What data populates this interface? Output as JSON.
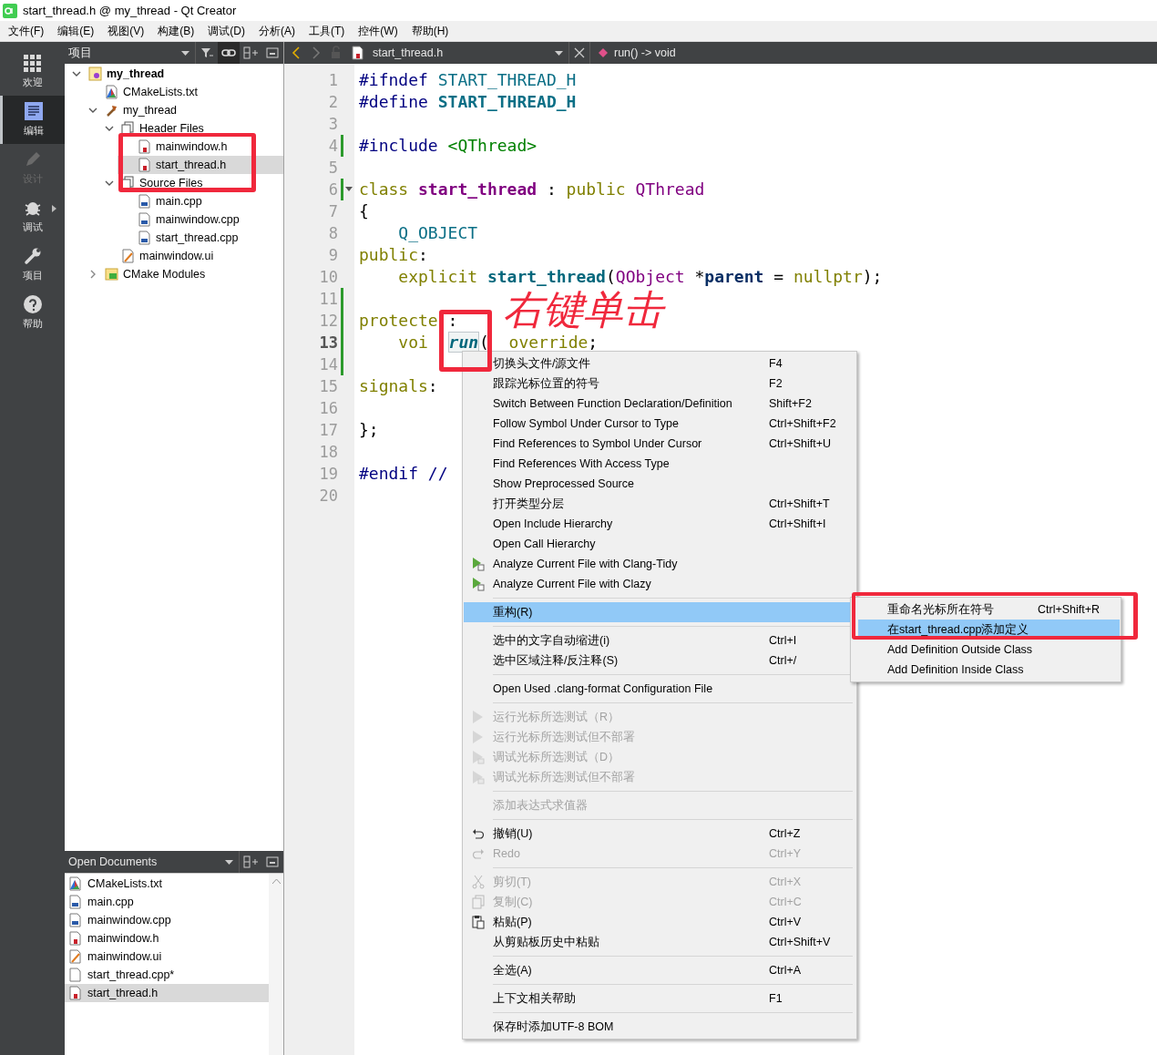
{
  "window": {
    "title": "start_thread.h @ my_thread - Qt Creator"
  },
  "menu_bar": [
    "文件(F)",
    "编辑(E)",
    "视图(V)",
    "构建(B)",
    "调试(D)",
    "分析(A)",
    "工具(T)",
    "控件(W)",
    "帮助(H)"
  ],
  "mode_bar": [
    {
      "label": "欢迎",
      "kind": "welcome",
      "selected": false,
      "disabled": false
    },
    {
      "label": "编辑",
      "kind": "edit",
      "selected": true,
      "disabled": false
    },
    {
      "label": "设计",
      "kind": "design",
      "selected": false,
      "disabled": true
    },
    {
      "label": "调试",
      "kind": "debug",
      "selected": false,
      "disabled": false
    },
    {
      "label": "项目",
      "kind": "projects",
      "selected": false,
      "disabled": false
    },
    {
      "label": "帮助",
      "kind": "help",
      "selected": false,
      "disabled": false
    }
  ],
  "project_panel": {
    "title": "项目",
    "tree": [
      {
        "label": "my_thread",
        "kind": "project",
        "expanded": true,
        "selected": false,
        "children": [
          {
            "label": "CMakeLists.txt",
            "kind": "cmake",
            "selected": false
          },
          {
            "label": "my_thread",
            "kind": "target",
            "expanded": true,
            "selected": false,
            "children": [
              {
                "label": "Header Files",
                "kind": "folder",
                "expanded": true,
                "selected": false,
                "children": [
                  {
                    "label": "mainwindow.h",
                    "kind": "header",
                    "selected": false
                  },
                  {
                    "label": "start_thread.h",
                    "kind": "header",
                    "selected": true
                  }
                ]
              },
              {
                "label": "Source Files",
                "kind": "folder",
                "expanded": true,
                "selected": false,
                "children": [
                  {
                    "label": "main.cpp",
                    "kind": "source",
                    "selected": false
                  },
                  {
                    "label": "mainwindow.cpp",
                    "kind": "source",
                    "selected": false
                  },
                  {
                    "label": "start_thread.cpp",
                    "kind": "source",
                    "selected": false
                  }
                ]
              },
              {
                "label": "mainwindow.ui",
                "kind": "form",
                "selected": false
              }
            ]
          },
          {
            "label": "CMake Modules",
            "kind": "modules",
            "expanded": false,
            "selected": false
          }
        ]
      }
    ]
  },
  "open_documents": {
    "title": "Open Documents",
    "items": [
      {
        "label": "CMakeLists.txt",
        "kind": "cmake",
        "selected": false
      },
      {
        "label": "main.cpp",
        "kind": "source",
        "selected": false
      },
      {
        "label": "mainwindow.cpp",
        "kind": "source",
        "selected": false
      },
      {
        "label": "mainwindow.h",
        "kind": "header",
        "selected": false
      },
      {
        "label": "mainwindow.ui",
        "kind": "form",
        "selected": false
      },
      {
        "label": "start_thread.cpp*",
        "kind": "plain",
        "selected": false
      },
      {
        "label": "start_thread.h",
        "kind": "header",
        "selected": true
      }
    ]
  },
  "editor": {
    "file": "start_thread.h",
    "symbol": "run() -> void",
    "lines": [
      {
        "number": "1",
        "tokens": [
          {
            "t": "#ifndef",
            "kind": "preproc"
          },
          {
            "t": " START_THREAD_H",
            "kind": "macro"
          }
        ]
      },
      {
        "number": "2",
        "tokens": [
          {
            "t": "#define",
            "kind": "preproc"
          },
          {
            "t": " START_THREAD_H",
            "kind": "macro-bold"
          }
        ]
      },
      {
        "number": "3"
      },
      {
        "number": "4",
        "changed": true,
        "tokens": [
          {
            "t": "#include",
            "kind": "preproc"
          },
          {
            "t": " <QThread>",
            "kind": "string"
          }
        ]
      },
      {
        "number": "5"
      },
      {
        "number": "6",
        "changed": true,
        "foldable": true,
        "tokens": [
          {
            "t": "class",
            "kind": "keyword"
          },
          {
            "t": " start_thread",
            "kind": "class-bold"
          },
          {
            "t": " :"
          },
          {
            "t": " public",
            "kind": "keyword"
          },
          {
            "t": " QThread",
            "kind": "type"
          }
        ]
      },
      {
        "number": "7",
        "tokens": [
          {
            "t": "{"
          }
        ]
      },
      {
        "number": "8",
        "tokens": [
          {
            "t": "    Q_OBJECT",
            "kind": "macro"
          }
        ]
      },
      {
        "number": "9",
        "tokens": [
          {
            "t": "public",
            "kind": "keyword"
          },
          {
            "t": ":"
          }
        ]
      },
      {
        "number": "10",
        "tokens": [
          {
            "t": "    explicit",
            "kind": "keyword"
          },
          {
            "t": " start_thread",
            "kind": "func-bold"
          },
          {
            "t": "("
          },
          {
            "t": "QObject",
            "kind": "type"
          },
          {
            "t": " *"
          },
          {
            "t": "parent",
            "kind": "param-bold"
          },
          {
            "t": " ="
          },
          {
            "t": " nullptr",
            "kind": "keyword"
          },
          {
            "t": ");"
          }
        ]
      },
      {
        "number": "11",
        "changed": true
      },
      {
        "number": "12",
        "changed": true,
        "tokens": [
          {
            "t": "protecte",
            "kind": "keyword"
          },
          {
            "t": " :"
          }
        ]
      },
      {
        "number": "13",
        "changed": true,
        "current": true,
        "tokens": [
          {
            "t": "    voi",
            "kind": "keyword"
          },
          {
            "t": "  run",
            "kind": "symbol"
          },
          {
            "t": "("
          },
          {
            "t": "  override",
            "kind": "keyword"
          },
          {
            "t": ";"
          }
        ]
      },
      {
        "number": "14",
        "changed": true
      },
      {
        "number": "15",
        "tokens": [
          {
            "t": "signals",
            "kind": "keyword"
          },
          {
            "t": ":"
          }
        ]
      },
      {
        "number": "16"
      },
      {
        "number": "17",
        "tokens": [
          {
            "t": "};"
          }
        ]
      },
      {
        "number": "18"
      },
      {
        "number": "19",
        "tokens": [
          {
            "t": "#endif //",
            "kind": "preproc"
          }
        ]
      },
      {
        "number": "20"
      }
    ]
  },
  "context_menu": {
    "items": [
      {
        "kind": "plain",
        "label": "切换头文件/源文件",
        "shortcut": "F4",
        "disabled": false,
        "selected": false
      },
      {
        "kind": "plain",
        "label": "跟踪光标位置的符号",
        "shortcut": "F2",
        "disabled": false,
        "selected": false
      },
      {
        "kind": "plain",
        "label": "Switch Between Function Declaration/Definition",
        "shortcut": "Shift+F2",
        "disabled": false,
        "selected": false
      },
      {
        "kind": "plain",
        "label": "Follow Symbol Under Cursor to Type",
        "shortcut": "Ctrl+Shift+F2",
        "disabled": false,
        "selected": false
      },
      {
        "kind": "plain",
        "label": "Find References to Symbol Under Cursor",
        "shortcut": "Ctrl+Shift+U",
        "disabled": false,
        "selected": false
      },
      {
        "kind": "plain",
        "label": "Find References With Access Type",
        "disabled": false,
        "selected": false
      },
      {
        "kind": "plain",
        "label": "Show Preprocessed Source",
        "disabled": false,
        "selected": false
      },
      {
        "kind": "plain",
        "label": "打开类型分层",
        "shortcut": "Ctrl+Shift+T",
        "disabled": false,
        "selected": false
      },
      {
        "kind": "plain",
        "label": "Open Include Hierarchy",
        "shortcut": "Ctrl+Shift+I",
        "disabled": false,
        "selected": false
      },
      {
        "kind": "plain",
        "label": "Open Call Hierarchy",
        "disabled": false,
        "selected": false
      },
      {
        "kind": "analyze",
        "label": "Analyze Current File with Clang-Tidy",
        "disabled": false,
        "selected": false
      },
      {
        "kind": "analyze",
        "label": "Analyze Current File with Clazy",
        "disabled": false,
        "selected": false
      },
      {
        "kind": "separator"
      },
      {
        "kind": "plain",
        "label": "重构(R)",
        "disabled": false,
        "selected": true
      },
      {
        "kind": "separator"
      },
      {
        "kind": "plain",
        "label": "选中的文字自动缩进(i)",
        "shortcut": "Ctrl+I",
        "disabled": false,
        "selected": false
      },
      {
        "kind": "plain",
        "label": "选中区域注释/反注释(S)",
        "shortcut": "Ctrl+/",
        "disabled": false,
        "selected": false
      },
      {
        "kind": "separator"
      },
      {
        "kind": "plain",
        "label": "Open Used .clang-format Configuration File",
        "disabled": false,
        "selected": false
      },
      {
        "kind": "separator"
      },
      {
        "kind": "run-test",
        "label": "运行光标所选测试（R）",
        "disabled": true,
        "selected": false
      },
      {
        "kind": "run-test",
        "label": "运行光标所选测试但不部署",
        "disabled": true,
        "selected": false
      },
      {
        "kind": "debug-test",
        "label": "调试光标所选测试（D）",
        "disabled": true,
        "selected": false
      },
      {
        "kind": "debug-test",
        "label": "调试光标所选测试但不部署",
        "disabled": true,
        "selected": false
      },
      {
        "kind": "separator"
      },
      {
        "kind": "plain",
        "label": "添加表达式求值器",
        "disabled": true,
        "selected": false
      },
      {
        "kind": "separator"
      },
      {
        "kind": "undo",
        "label": "撤销(U)",
        "shortcut": "Ctrl+Z",
        "disabled": false,
        "selected": false
      },
      {
        "kind": "redo",
        "label": "Redo",
        "shortcut": "Ctrl+Y",
        "disabled": true,
        "selected": false
      },
      {
        "kind": "separator"
      },
      {
        "kind": "cut",
        "label": "剪切(T)",
        "shortcut": "Ctrl+X",
        "disabled": true,
        "selected": false
      },
      {
        "kind": "copy",
        "label": "复制(C)",
        "shortcut": "Ctrl+C",
        "disabled": true,
        "selected": false
      },
      {
        "kind": "paste",
        "label": "粘贴(P)",
        "shortcut": "Ctrl+V",
        "disabled": false,
        "selected": false
      },
      {
        "kind": "plain",
        "label": "从剪贴板历史中粘贴",
        "shortcut": "Ctrl+Shift+V",
        "disabled": false,
        "selected": false
      },
      {
        "kind": "separator"
      },
      {
        "kind": "plain",
        "label": "全选(A)",
        "shortcut": "Ctrl+A",
        "disabled": false,
        "selected": false
      },
      {
        "kind": "separator"
      },
      {
        "kind": "plain",
        "label": "上下文相关帮助",
        "shortcut": "F1",
        "disabled": false,
        "selected": false
      },
      {
        "kind": "separator"
      },
      {
        "kind": "plain",
        "label": "保存时添加UTF-8 BOM",
        "disabled": false,
        "selected": false
      }
    ]
  },
  "submenu": {
    "items": [
      {
        "label": "重命名光标所在符号",
        "shortcut": "Ctrl+Shift+R",
        "disabled": false,
        "selected": false
      },
      {
        "label": "在start_thread.cpp添加定义",
        "disabled": false,
        "selected": true
      },
      {
        "label": "Add Definition Outside Class",
        "disabled": false,
        "selected": false
      },
      {
        "label": "Add Definition Inside Class",
        "disabled": false,
        "selected": false
      }
    ]
  },
  "annotation": {
    "text": "右键单击"
  }
}
